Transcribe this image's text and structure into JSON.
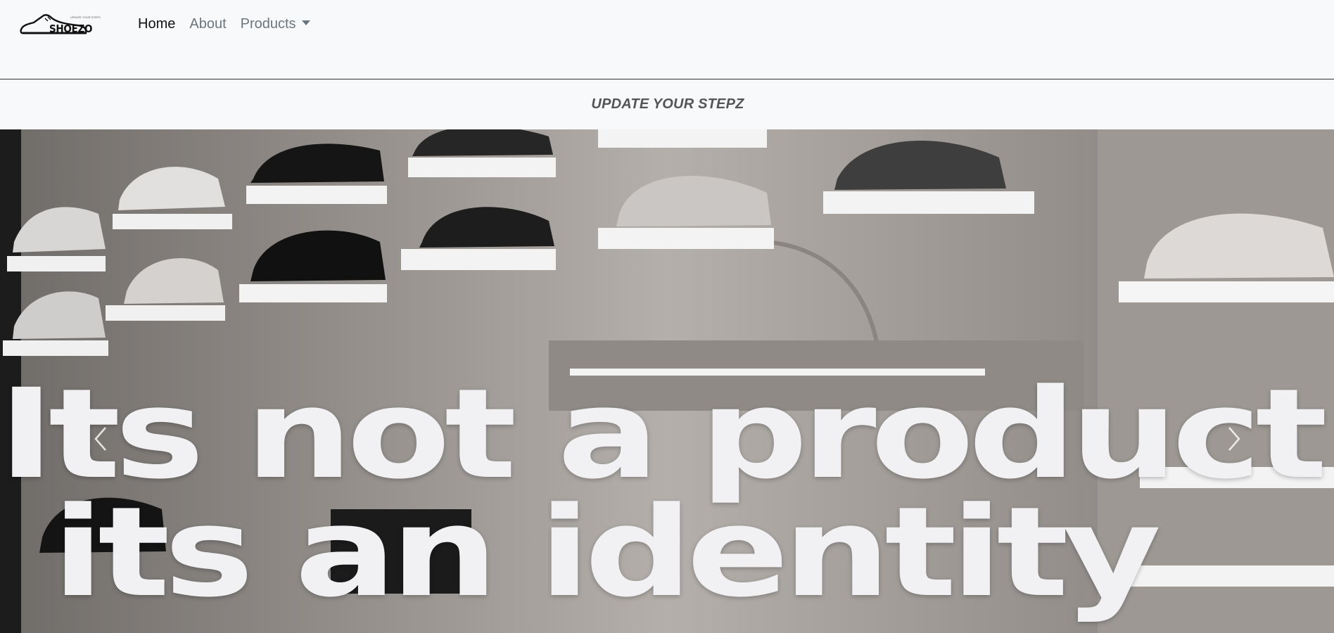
{
  "brand": {
    "name": "SHOEZO",
    "tagline": "UPDATE YOUR STEPS",
    "icon": "sneaker-logo-icon"
  },
  "nav": {
    "items": [
      {
        "label": "Home",
        "active": true
      },
      {
        "label": "About",
        "active": false
      },
      {
        "label": "Products",
        "active": false,
        "dropdown": true
      }
    ]
  },
  "tagline_bar": {
    "text": "UPDATE YOUR STEPZ"
  },
  "hero": {
    "line1": "Its not a product",
    "line2": "its an identity",
    "prev_icon": "chevron-left-icon",
    "next_icon": "chevron-right-icon"
  },
  "colors": {
    "background": "#f8f9fa",
    "nav_active": "#111111",
    "nav_muted": "#6c757d",
    "hero_text": "#f1f1f4"
  }
}
